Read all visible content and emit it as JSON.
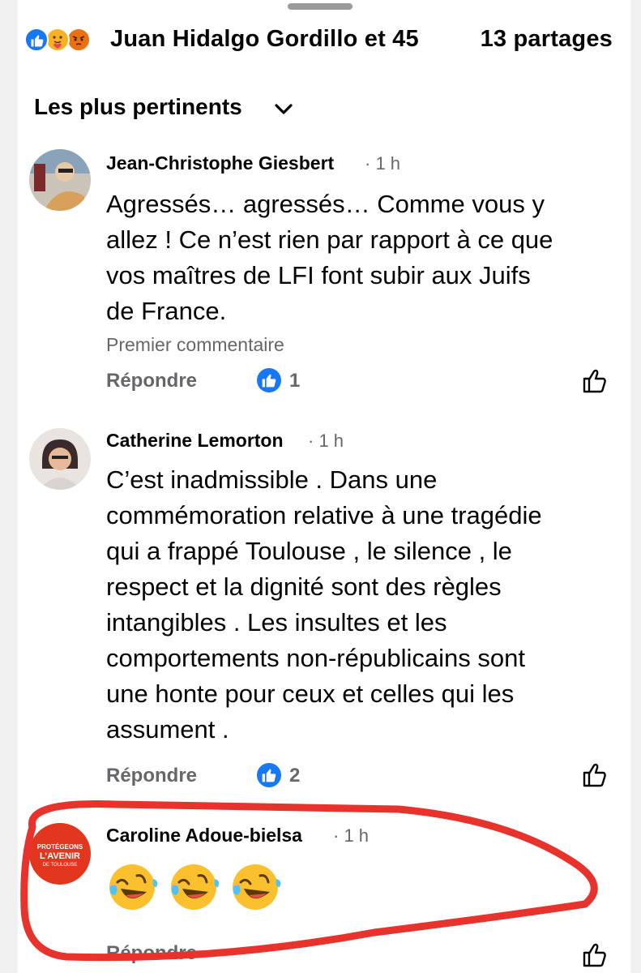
{
  "reactions": {
    "icons": [
      "like-icon",
      "care-icon",
      "angry-icon"
    ],
    "names": "Juan Hidalgo Gordillo et 45",
    "shares": "13 partages"
  },
  "sort": {
    "label": "Les plus pertinents",
    "icon": "chevron-down-icon"
  },
  "comments": [
    {
      "author": "Jean-Christophe Giesbert",
      "time": "· 1 h",
      "text": "Agressés… agressés… Comme vous y allez ! Ce n’est rien par rapport à ce que vos maîtres de LFI font subir aux Juifs de France.",
      "lines": [
        "Agressés… agressés… Comme vous y",
        "allez ! Ce n’est rien par rapport à ce que",
        "vos maîtres de LFI font subir aux Juifs",
        "de France."
      ],
      "badge": "Premier commentaire",
      "reply": "Répondre",
      "likes": "1"
    },
    {
      "author": "Catherine Lemorton",
      "time": "· 1 h",
      "lines": [
        "C’est inadmissible . Dans une",
        "commémoration relative à une tragédie",
        "qui a frappé Toulouse , le silence , le",
        "respect et la dignité sont des règles",
        "intangibles . Les insultes et les",
        "comportements non-républicains sont",
        "une honte pour ceux et celles qui les",
        "assument ."
      ],
      "reply": "Répondre",
      "likes": "2"
    },
    {
      "author": "Caroline Adoue-bielsa",
      "time": "· 1 h",
      "emojis": [
        "rolling-laughing-emoji",
        "rolling-laughing-emoji",
        "rolling-laughing-emoji"
      ],
      "avatar_text": [
        "PROTÉGEONS",
        "L’AVENIR",
        "DE TOULOUSE"
      ],
      "reply": "Répondre"
    }
  ],
  "colors": {
    "accent": "#1877f2",
    "annotation": "#e8322c",
    "muted": "#65676b"
  }
}
